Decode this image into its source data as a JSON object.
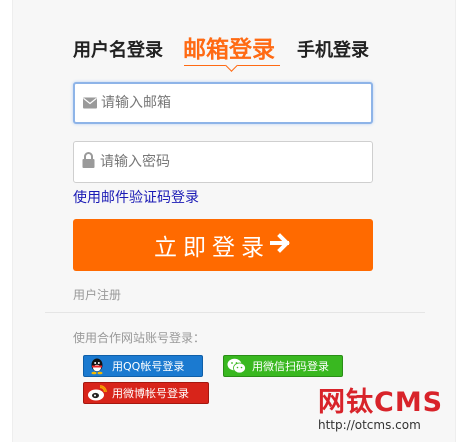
{
  "tabs": {
    "username": "用户名登录",
    "email": "邮箱登录",
    "phone": "手机登录"
  },
  "form": {
    "email_placeholder": "请输入邮箱",
    "password_placeholder": "请输入密码",
    "code_login_link": "使用邮件验证码登录",
    "submit_label": "立即登录"
  },
  "register_link": "用户注册",
  "partner": {
    "label": "使用合作网站账号登录：",
    "qq": "用QQ帐号登录",
    "wechat": "用微信扫码登录",
    "weibo": "用微博帐号登录"
  },
  "watermark": {
    "logo": "网钛CMS",
    "url": "http://otcms.com"
  },
  "colors": {
    "accent": "#ff6a13",
    "link": "#1a1ab5",
    "qq": "#1b7ad0",
    "wechat": "#39b820",
    "weibo": "#d8241a"
  },
  "icons": [
    "envelope-icon",
    "lock-icon",
    "arrow-right-icon",
    "qq-icon",
    "wechat-icon",
    "weibo-icon"
  ]
}
